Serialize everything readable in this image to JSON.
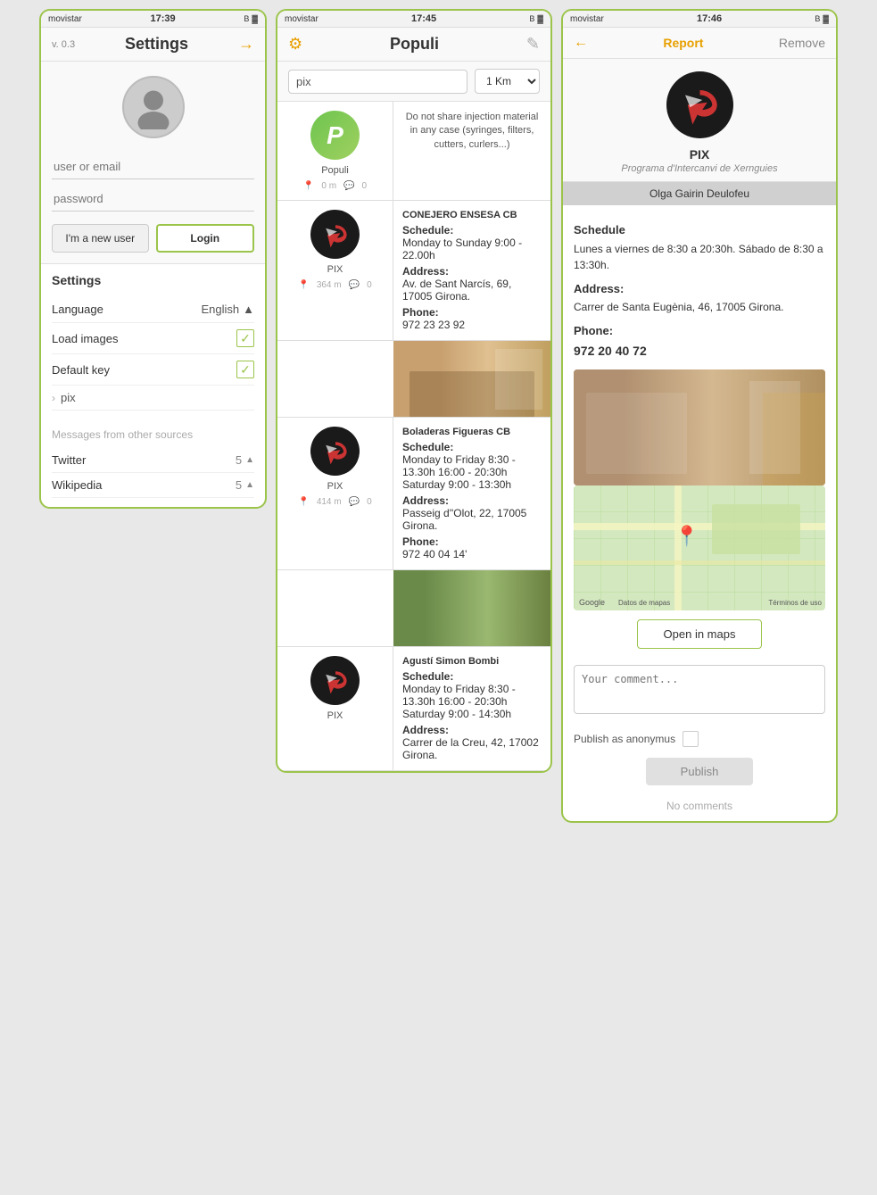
{
  "phone1": {
    "status": {
      "carrier": "movistar",
      "time": "17:39",
      "icons": "bluetooth battery"
    },
    "header": {
      "version": "v. 0.3",
      "title": "Settings",
      "arrow": "→"
    },
    "form": {
      "username_placeholder": "user or email",
      "password_placeholder": "password",
      "new_user_label": "I'm a new user",
      "login_label": "Login"
    },
    "settings": {
      "title": "Settings",
      "rows": [
        {
          "label": "Language",
          "value": "English",
          "type": "select"
        },
        {
          "label": "Load images",
          "value": "",
          "type": "checkbox"
        },
        {
          "label": "Default key",
          "value": "",
          "type": "checkbox"
        }
      ],
      "sub_row": "pix"
    },
    "messages": {
      "title": "Messages from other sources",
      "rows": [
        {
          "label": "Twitter",
          "value": "5"
        },
        {
          "label": "Wikipedia",
          "value": "5"
        }
      ]
    }
  },
  "phone2": {
    "status": {
      "carrier": "movistar",
      "time": "17:45",
      "icons": "bluetooth battery"
    },
    "header": {
      "title": "Populi"
    },
    "search": {
      "value": "pix",
      "km_value": "1 Km"
    },
    "items": [
      {
        "org_type": "populi",
        "org_name": "Populi",
        "desc": "Do not share injection material in any case (syringes, filters, cutters, curlers...)",
        "distance": "0 m",
        "comments": "0"
      },
      {
        "org_type": "pix",
        "org_name": "PIX",
        "business_name": "CONEJERO ENSESA CB",
        "schedule_label": "Schedule:",
        "schedule": "Monday to Sunday 9:00 - 22.00h",
        "address_label": "Address:",
        "address": "Av. de Sant Narcís, 69, 17005 Girona.",
        "phone_label": "Phone:",
        "phone": "972 23 23 92",
        "has_photo": true,
        "distance": "364 m",
        "comments": "0"
      },
      {
        "org_type": "pix",
        "org_name": "PIX",
        "business_name": "Boladeras Figueras CB",
        "schedule_label": "Schedule:",
        "schedule": "Monday to Friday 8:30 - 13.30h\n16:00 - 20:30h\nSaturday\n9:00 - 13:30h",
        "address_label": "Address:",
        "address": "Passeig d''Olot, 22, 17005 Girona.",
        "phone_label": "Phone:",
        "phone": "972 40 04 14'",
        "has_photo": true,
        "distance": "414 m",
        "comments": "0"
      },
      {
        "org_type": "pix",
        "org_name": "PIX",
        "business_name": "Agustí Simon Bombi",
        "schedule_label": "Schedule:",
        "schedule": "Monday to Friday 8:30 - 13.30h\n16:00 - 20:30h\nSaturday\n9:00 - 14:30h",
        "address_label": "Address:",
        "address": "Carrer de la Creu, 42, 17002 Girona.",
        "has_photo": false
      }
    ]
  },
  "phone3": {
    "status": {
      "carrier": "movistar",
      "time": "17:46",
      "icons": "bluetooth battery"
    },
    "header": {
      "back": "←",
      "report": "Report",
      "remove": "Remove"
    },
    "org": {
      "name": "PIX",
      "subtitle": "Programa d'Intercanvi de Xernguies"
    },
    "person": "Olga Gairin Deulofeu",
    "schedule_label": "Schedule",
    "schedule": "Lunes a viernes de 8:30 a 20:30h.\nSábado de 8:30 a 13:30h.",
    "address_label": "Address:",
    "address": "Carrer de Santa Eugènia, 46,\n17005 Girona.",
    "phone_label": "Phone:",
    "phone": "972 20 40 72",
    "open_maps_label": "Open in maps",
    "comment_placeholder": "Your comment...",
    "anon_label": "Publish as anonymus",
    "publish_label": "Publish",
    "no_comments": "No comments"
  }
}
